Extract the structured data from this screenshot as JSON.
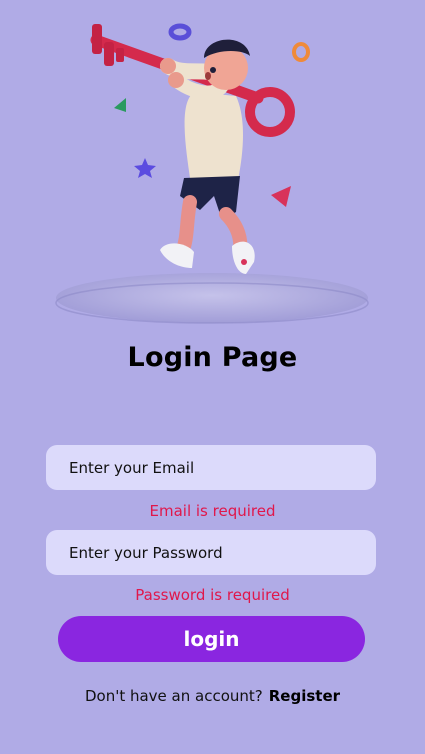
{
  "page": {
    "title": "Login Page"
  },
  "form": {
    "email_placeholder": "Enter your Email",
    "email_value": "",
    "email_error": "Email is required",
    "password_placeholder": "Enter your Password",
    "password_value": "",
    "password_error": "Password is required",
    "submit_label": "login"
  },
  "footer": {
    "prompt_text": "Don't have an account?",
    "register_link": "Register"
  },
  "colors": {
    "background": "#b0abe6",
    "input_bg": "#dcdafb",
    "error": "#e0174b",
    "button": "#8a26e0"
  },
  "hero": {
    "illustration": "boy-carrying-key-illustration"
  }
}
